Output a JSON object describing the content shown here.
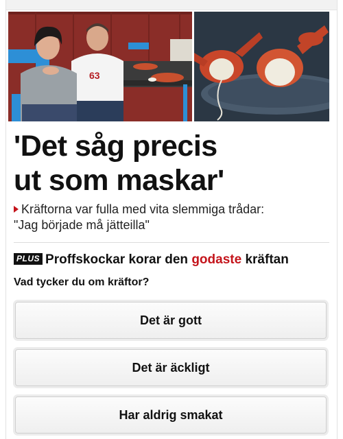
{
  "article": {
    "headline_line1": "'Det såg precis",
    "headline_line2": "ut som maskar'",
    "subline_line1": "Kräftorna var fulla med vita slemmiga trådar:",
    "subline_line2": "\"Jag började må jätteilla\""
  },
  "promo": {
    "badge": "PLUS",
    "text_before": "Proffskockar korar den ",
    "highlight": "godaste",
    "text_after": " kräftan"
  },
  "poll": {
    "question": "Vad tycker du om kräftor?",
    "options": [
      "Det är gott",
      "Det är äckligt",
      "Har aldrig smakat"
    ]
  },
  "colors": {
    "accent": "#c4141b",
    "badge": "#111111"
  }
}
